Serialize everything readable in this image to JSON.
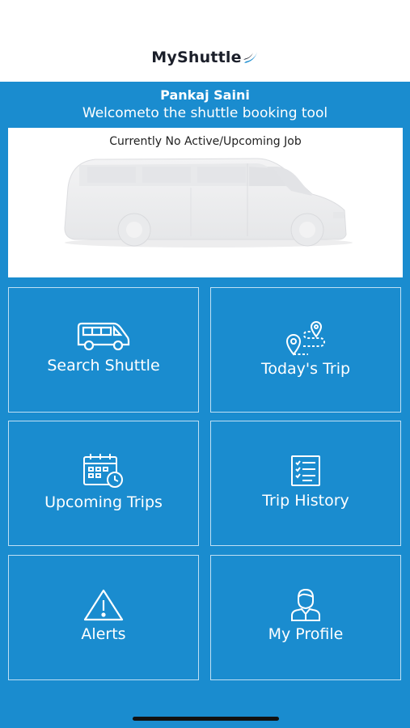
{
  "app": {
    "logo_text": "MyShuttle",
    "user_name": "Pankaj Saini",
    "welcome": "Welcometo the shuttle booking tool"
  },
  "job_card": {
    "status": "Currently No Active/Upcoming Job"
  },
  "tiles": [
    {
      "label": "Search Shuttle",
      "icon": "van-icon"
    },
    {
      "label": "Today's Trip",
      "icon": "route-pin-icon"
    },
    {
      "label": "Upcoming Trips",
      "icon": "calendar-clock-icon"
    },
    {
      "label": "Trip History",
      "icon": "checklist-icon"
    },
    {
      "label": "Alerts",
      "icon": "warning-icon"
    },
    {
      "label": "My Profile",
      "icon": "user-profile-icon"
    }
  ],
  "colors": {
    "primary": "#1a8ccf",
    "tile_border": "#bfe0f4",
    "white": "#ffffff"
  }
}
